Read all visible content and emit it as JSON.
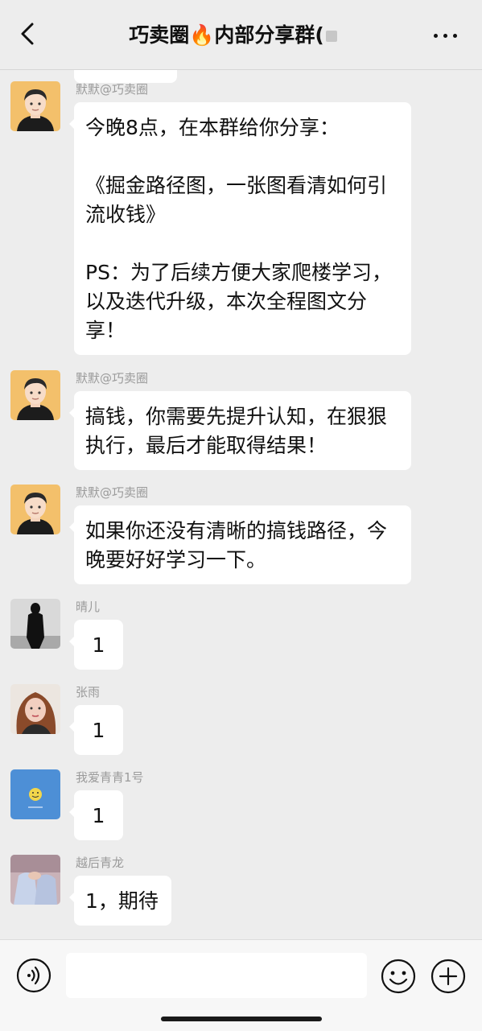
{
  "header": {
    "title": "巧卖圈",
    "fire_emoji": "🔥",
    "title_suffix": "内部分享群("
  },
  "messages": [
    {
      "sender": "默默@巧卖圈",
      "avatar": "cartoon-man-avatar",
      "paragraphs": [
        "今晚8点，在本群给你分享：",
        "《掘金路径图，一张图看清如何引流收钱》",
        "PS：为了后续方便大家爬楼学习，以及迭代升级，本次全程图文分享！"
      ]
    },
    {
      "sender": "默默@巧卖圈",
      "avatar": "cartoon-man-avatar",
      "text": "搞钱，你需要先提升认知，在狠狠执行，最后才能取得结果！"
    },
    {
      "sender": "默默@巧卖圈",
      "avatar": "cartoon-man-avatar",
      "text": "如果你还没有清晰的搞钱路径，今晚要好好学习一下。"
    },
    {
      "sender": "晴儿",
      "avatar": "silhouette-photo-avatar",
      "text": "1"
    },
    {
      "sender": "张雨",
      "avatar": "woman-photo-avatar",
      "text": "1"
    },
    {
      "sender": "我爱青青1号",
      "avatar": "smiley-blue-avatar",
      "text": "1"
    },
    {
      "sender": "越后青龙",
      "avatar": "hands-photo-avatar",
      "text": "1，期待"
    }
  ],
  "input_bar": {
    "placeholder": "",
    "voice_icon": "voice-icon",
    "emoji_icon": "emoji-icon",
    "plus_icon": "plus-icon"
  },
  "colors": {
    "background": "#ededed",
    "bubble": "#ffffff",
    "sender_text": "#9b9b9b"
  }
}
